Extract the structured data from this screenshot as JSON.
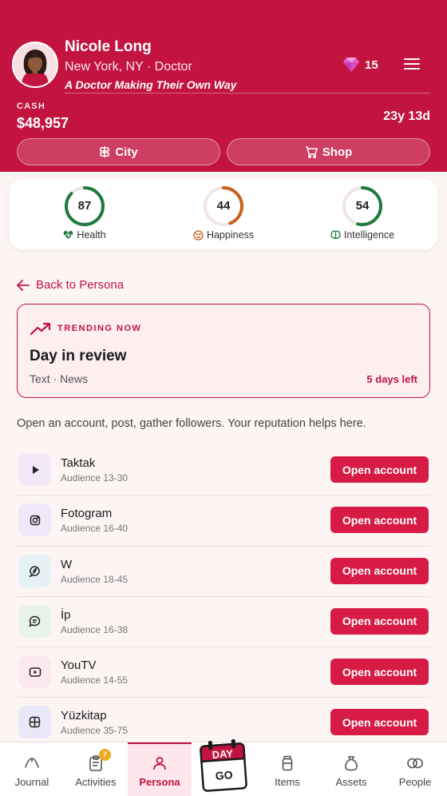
{
  "header": {
    "name": "Nicole Long",
    "subline": "New York, NY · Doctor",
    "tagline": "A Doctor Making Their Own Way",
    "gems": "15",
    "cash_label": "CASH",
    "cash_value": "$48,957",
    "age": "23y 13d",
    "city_label": "City",
    "shop_label": "Shop"
  },
  "stats": [
    {
      "value": "87",
      "label": "Health",
      "color": "#1e7a3e",
      "pct": 0.87
    },
    {
      "value": "44",
      "label": "Happiness",
      "color": "#c8601a",
      "pct": 0.44
    },
    {
      "value": "54",
      "label": "Intelligence",
      "color": "#1e7a3e",
      "pct": 0.54
    }
  ],
  "back_label": "Back to Persona",
  "trending": {
    "eyebrow": "TRENDING NOW",
    "title": "Day in review",
    "sub": "Text · News",
    "time_left": "5 days left"
  },
  "description": "Open an account, post, gather followers. Your reputation helps here.",
  "platforms": [
    {
      "name": "Taktak",
      "audience": "Audience 13-30",
      "button": "Open account",
      "icon": "play-icon",
      "bg": "#f3e8f8"
    },
    {
      "name": "Fotogram",
      "audience": "Audience 16-40",
      "button": "Open account",
      "icon": "camera-icon",
      "bg": "#efe8f8"
    },
    {
      "name": "W",
      "audience": "Audience 18-45",
      "button": "Open account",
      "icon": "bird-icon",
      "bg": "#e6f1f5"
    },
    {
      "name": "İp",
      "audience": "Audience 16-38",
      "button": "Open account",
      "icon": "chat-icon",
      "bg": "#e8f3ec"
    },
    {
      "name": "YouTV",
      "audience": "Audience 14-55",
      "button": "Open account",
      "icon": "video-icon",
      "bg": "#fbe9ee"
    },
    {
      "name": "Yüzkitap",
      "audience": "Audience 35-75",
      "button": "Open account",
      "icon": "grid-icon",
      "bg": "#e9e8f8"
    }
  ],
  "nav": {
    "journal": "Journal",
    "activities": "Activities",
    "activities_badge": "7",
    "persona": "Persona",
    "day_top": "DAY",
    "day_bottom": "GO",
    "items": "Items",
    "assets": "Assets",
    "people": "People"
  },
  "colors": {
    "brand": "#c2143f",
    "button": "#d81b45"
  }
}
